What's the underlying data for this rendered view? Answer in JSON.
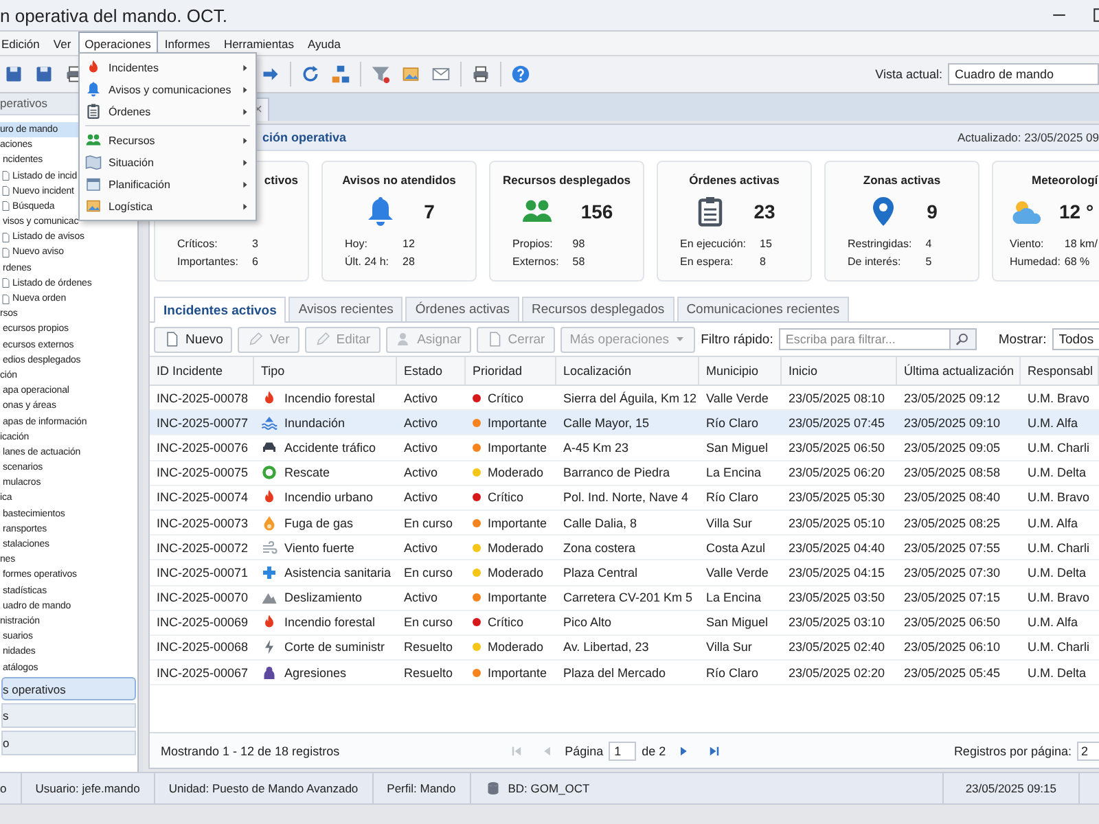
{
  "window": {
    "title": "n operativa del mando. OCT."
  },
  "menu_bar": [
    {
      "label": "Edición",
      "selected": false
    },
    {
      "label": "Ver",
      "selected": false
    },
    {
      "label": "Operaciones",
      "selected": true
    },
    {
      "label": "Informes",
      "selected": false
    },
    {
      "label": "Herramientas",
      "selected": false
    },
    {
      "label": "Ayuda",
      "selected": false
    }
  ],
  "open_menu": {
    "groups": [
      [
        {
          "label": "Incidentes",
          "kind": "fire"
        },
        {
          "label": "Avisos y comunicaciones",
          "kind": "bell"
        },
        {
          "label": "Órdenes",
          "kind": "clipboard"
        }
      ],
      [
        {
          "label": "Recursos",
          "kind": "people"
        },
        {
          "label": "Situación",
          "kind": "map"
        },
        {
          "label": "Planificación",
          "kind": "calendar"
        },
        {
          "label": "Logística",
          "kind": "image"
        }
      ]
    ]
  },
  "toolbar": {
    "view_label": "Vista actual:",
    "view_value": "Cuadro de mando"
  },
  "sidebar": {
    "title": "perativos",
    "tree": [
      {
        "label": "uro de mando",
        "selected": true
      },
      {
        "label": "aciones",
        "selected": false,
        "children": [
          {
            "label": "ncidentes",
            "selected": false,
            "children": [
              {
                "label": "Listado de incid",
                "selected": false
              },
              {
                "label": "Nuevo incident",
                "selected": false
              },
              {
                "label": "Búsqueda",
                "selected": false
              }
            ]
          },
          {
            "label": "visos y comunicac",
            "selected": false,
            "children": [
              {
                "label": "Listado de avisos",
                "selected": false
              },
              {
                "label": "Nuevo aviso",
                "selected": false
              }
            ]
          },
          {
            "label": "rdenes",
            "selected": false,
            "children": [
              {
                "label": "Listado de órdenes",
                "selected": false
              },
              {
                "label": "Nueva orden",
                "selected": false
              }
            ]
          }
        ]
      },
      {
        "label": "rsos",
        "selected": false,
        "children": [
          {
            "label": "ecursos propios",
            "selected": false
          },
          {
            "label": "ecursos externos",
            "selected": false
          },
          {
            "label": "edios desplegados",
            "selected": false
          }
        ]
      },
      {
        "label": "ción",
        "selected": false,
        "children": [
          {
            "label": "apa operacional",
            "selected": false
          },
          {
            "label": "onas y áreas",
            "selected": false
          },
          {
            "label": "apas de información",
            "selected": false
          }
        ]
      },
      {
        "label": "icación",
        "selected": false,
        "children": [
          {
            "label": "lanes de actuación",
            "selected": false
          },
          {
            "label": "scenarios",
            "selected": false
          },
          {
            "label": "mulacros",
            "selected": false
          }
        ]
      },
      {
        "label": "ica",
        "selected": false,
        "children": [
          {
            "label": "bastecimientos",
            "selected": false
          },
          {
            "label": "ransportes",
            "selected": false
          },
          {
            "label": "stalaciones",
            "selected": false
          }
        ]
      },
      {
        "label": "nes",
        "selected": false,
        "children": [
          {
            "label": "formes operativos",
            "selected": false
          },
          {
            "label": "stadísticas",
            "selected": false
          },
          {
            "label": "uadro de mando",
            "selected": false
          }
        ]
      },
      {
        "label": "nistración",
        "selected": false,
        "children": [
          {
            "label": "suarios",
            "selected": false
          },
          {
            "label": "nidades",
            "selected": false
          },
          {
            "label": "atálogos",
            "selected": false
          }
        ]
      }
    ],
    "sections": [
      {
        "label": "s operativos",
        "selected": true
      },
      {
        "label": "s",
        "selected": false
      },
      {
        "label": "o",
        "selected": false
      }
    ]
  },
  "document_tab": {
    "close": "×"
  },
  "panel": {
    "title": "ción operativa",
    "updated": "Actualizado: 23/05/2025 09"
  },
  "cards": [
    {
      "title": "ctivos",
      "stats": [
        {
          "label": "Críticos:",
          "value": "3"
        },
        {
          "label": "Importantes:",
          "value": "6"
        }
      ]
    },
    {
      "title": "Avisos no atendidos",
      "kind": "bell",
      "value": "7",
      "stats": [
        {
          "label": "Hoy:",
          "value": "12"
        },
        {
          "label": "Últ. 24 h:",
          "value": "28"
        }
      ]
    },
    {
      "title": "Recursos desplegados",
      "kind": "people",
      "value": "156",
      "stats": [
        {
          "label": "Propios:",
          "value": "98"
        },
        {
          "label": "Externos:",
          "value": "58"
        }
      ]
    },
    {
      "title": "Órdenes activas",
      "kind": "clipboard",
      "value": "23",
      "stats": [
        {
          "label": "En ejecución:",
          "value": "15"
        },
        {
          "label": "En espera:",
          "value": "8"
        }
      ]
    },
    {
      "title": "Zonas activas",
      "kind": "pin",
      "value": "9",
      "stats": [
        {
          "label": "Restringidas:",
          "value": "4"
        },
        {
          "label": "De interés:",
          "value": "5"
        }
      ]
    },
    {
      "title": "Meteorologí",
      "kind": "weather",
      "value": "12 °",
      "stats": [
        {
          "label": "Viento:",
          "value": "18 km/"
        },
        {
          "label": "Humedad:",
          "value": "68 %"
        }
      ]
    }
  ],
  "tabs": [
    {
      "label": "Incidentes activos",
      "selected": true
    },
    {
      "label": "Avisos recientes",
      "selected": false
    },
    {
      "label": "Órdenes activas",
      "selected": false
    },
    {
      "label": "Recursos desplegados",
      "selected": false
    },
    {
      "label": "Comunicaciones recientes",
      "selected": false
    }
  ],
  "actions": [
    {
      "label": "Nuevo",
      "kind": "new",
      "disabled": false
    },
    {
      "label": "Ver",
      "kind": "view",
      "disabled": true
    },
    {
      "label": "Editar",
      "kind": "edit",
      "disabled": true
    },
    {
      "label": "Asignar",
      "kind": "assign",
      "disabled": true
    },
    {
      "label": "Cerrar",
      "kind": "close",
      "disabled": true
    },
    {
      "label": "Más operaciones",
      "kind": "more",
      "disabled": true
    }
  ],
  "filter": {
    "label": "Filtro rápido:",
    "placeholder": "Escriba para filtrar...",
    "show_label": "Mostrar:",
    "show_value": "Todos"
  },
  "table": {
    "columns": [
      "ID Incidente",
      "Tipo",
      "Estado",
      "Prioridad",
      "Localización",
      "Municipio",
      "Inicio",
      "Última actualización",
      "Responsabl"
    ],
    "rows": [
      {
        "id": "INC-2025-00078",
        "kind": "fire",
        "type": "Incendio forestal",
        "status": "Activo",
        "priority": "Crítico",
        "color": "#d7191c",
        "location": "Sierra del Águila, Km 12",
        "municipality": "Valle Verde",
        "start": "23/05/2025 08:10",
        "updated": "23/05/2025 09:12",
        "responsible": "U.M. Bravo",
        "selected": false
      },
      {
        "id": "INC-2025-00077",
        "kind": "flood",
        "type": "Inundación",
        "status": "Activo",
        "priority": "Importante",
        "color": "#f5841f",
        "location": "Calle Mayor, 15",
        "municipality": "Río Claro",
        "start": "23/05/2025 07:45",
        "updated": "23/05/2025 09:10",
        "responsible": "U.M. Alfa",
        "selected": true
      },
      {
        "id": "INC-2025-00076",
        "kind": "car",
        "type": "Accidente tráfico",
        "status": "Activo",
        "priority": "Importante",
        "color": "#f5841f",
        "location": "A-45 Km 23",
        "municipality": "San Miguel",
        "start": "23/05/2025 06:50",
        "updated": "23/05/2025 09:05",
        "responsible": "U.M. Charli",
        "selected": false
      },
      {
        "id": "INC-2025-00075",
        "kind": "rescue",
        "type": "Rescate",
        "status": "Activo",
        "priority": "Moderado",
        "color": "#f5c518",
        "location": "Barranco de Piedra",
        "municipality": "La Encina",
        "start": "23/05/2025 06:20",
        "updated": "23/05/2025 08:58",
        "responsible": "U.M. Delta",
        "selected": false
      },
      {
        "id": "INC-2025-00074",
        "kind": "fire",
        "type": "Incendio urbano",
        "status": "Activo",
        "priority": "Crítico",
        "color": "#d7191c",
        "location": "Pol. Ind. Norte, Nave 4",
        "municipality": "Río Claro",
        "start": "23/05/2025 05:30",
        "updated": "23/05/2025 08:40",
        "responsible": "U.M. Bravo",
        "selected": false
      },
      {
        "id": "INC-2025-00073",
        "kind": "gas",
        "type": "Fuga de gas",
        "status": "En curso",
        "priority": "Importante",
        "color": "#f5841f",
        "location": "Calle Dalia, 8",
        "municipality": "Villa Sur",
        "start": "23/05/2025 05:10",
        "updated": "23/05/2025 08:25",
        "responsible": "U.M. Alfa",
        "selected": false
      },
      {
        "id": "INC-2025-00072",
        "kind": "wind",
        "type": "Viento fuerte",
        "status": "Activo",
        "priority": "Moderado",
        "color": "#f5c518",
        "location": "Zona costera",
        "municipality": "Costa Azul",
        "start": "23/05/2025 04:40",
        "updated": "23/05/2025 07:55",
        "responsible": "U.M. Charli",
        "selected": false
      },
      {
        "id": "INC-2025-00071",
        "kind": "medical",
        "type": "Asistencia sanitaria",
        "status": "En curso",
        "priority": "Moderado",
        "color": "#f5c518",
        "location": "Plaza Central",
        "municipality": "Valle Verde",
        "start": "23/05/2025 04:15",
        "updated": "23/05/2025 07:30",
        "responsible": "U.M. Delta",
        "selected": false
      },
      {
        "id": "INC-2025-00070",
        "kind": "landslide",
        "type": "Deslizamiento",
        "status": "Activo",
        "priority": "Importante",
        "color": "#f5841f",
        "location": "Carretera CV-201 Km 5",
        "municipality": "La Encina",
        "start": "23/05/2025 03:50",
        "updated": "23/05/2025 07:15",
        "responsible": "U.M. Bravo",
        "selected": false
      },
      {
        "id": "INC-2025-00069",
        "kind": "fire",
        "type": "Incendio forestal",
        "status": "En curso",
        "priority": "Crítico",
        "color": "#d7191c",
        "location": "Pico Alto",
        "municipality": "San Miguel",
        "start": "23/05/2025 03:10",
        "updated": "23/05/2025 06:50",
        "responsible": "U.M. Alfa",
        "selected": false
      },
      {
        "id": "INC-2025-00068",
        "kind": "power",
        "type": "Corte de suministr",
        "status": "Resuelto",
        "priority": "Moderado",
        "color": "#f5c518",
        "location": "Av. Libertad, 23",
        "municipality": "Villa Sur",
        "start": "23/05/2025 02:40",
        "updated": "23/05/2025 06:10",
        "responsible": "U.M. Charli",
        "selected": false
      },
      {
        "id": "INC-2025-00067",
        "kind": "aggression",
        "type": "Agresiones",
        "status": "Resuelto",
        "priority": "Importante",
        "color": "#f5841f",
        "location": "Plaza del Mercado",
        "municipality": "Río Claro",
        "start": "23/05/2025 02:20",
        "updated": "23/05/2025 05:45",
        "responsible": "U.M. Delta",
        "selected": false
      }
    ]
  },
  "pagination": {
    "summary": "Mostrando 1 - 12 de 18 registros",
    "page_label": "Página",
    "page": "1",
    "of": "de 2",
    "per_page_label": "Registros por página:",
    "per_page": "2",
    "nav": [
      {
        "kind": "first",
        "disabled": true
      },
      {
        "kind": "prev",
        "disabled": true
      },
      {
        "kind": "next",
        "disabled": false
      },
      {
        "kind": "last",
        "disabled": false
      }
    ]
  },
  "status_bar": {
    "items": [
      {
        "label": "o"
      },
      {
        "label": "Usuario: jefe.mando"
      },
      {
        "label": "Unidad: Puesto de Mando Avanzado"
      },
      {
        "label": "Perfil:  Mando"
      },
      {
        "label": "BD: GOM_OCT",
        "kind": "db"
      }
    ],
    "clock": "23/05/2025 09:15"
  }
}
